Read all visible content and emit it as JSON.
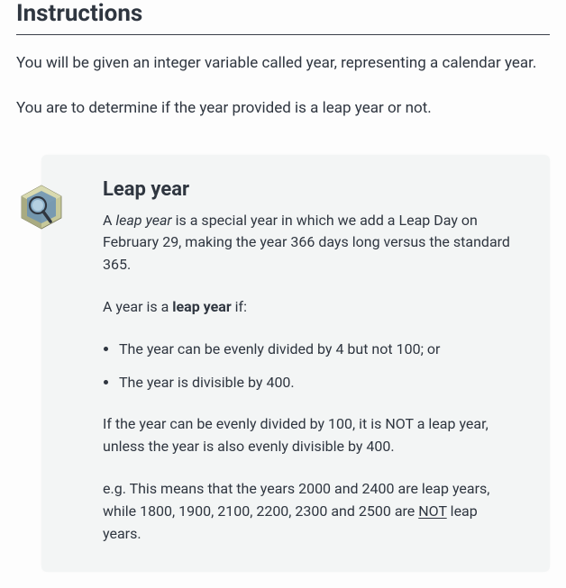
{
  "section": {
    "title": "Instructions",
    "intro1": "You will be given an integer variable called year, representing a calendar year.",
    "intro2": "You are to determine if the year provided is a leap year or not."
  },
  "callout": {
    "title": "Leap year",
    "def_pre": "A ",
    "def_term": "leap year",
    "def_post": " is a special year in which we add a Leap Day on February 29, making the year 366 days long versus the standard 365.",
    "cond_pre": "A year is a ",
    "cond_term": "leap year",
    "cond_post": " if:",
    "bullets": [
      "The year can be evenly divided by 4 but not 100; or",
      "The year is divisible by 400."
    ],
    "rule100": "If the year can be evenly divided by 100, it is NOT a leap year, unless the year is also evenly divisible by 400.",
    "example_pre": "e.g. This means that the years 2000 and 2400 are leap years, while 1800, 1900, 2100, 2200, 2300 and 2500 are ",
    "example_not": "NOT",
    "example_post": " leap years."
  }
}
